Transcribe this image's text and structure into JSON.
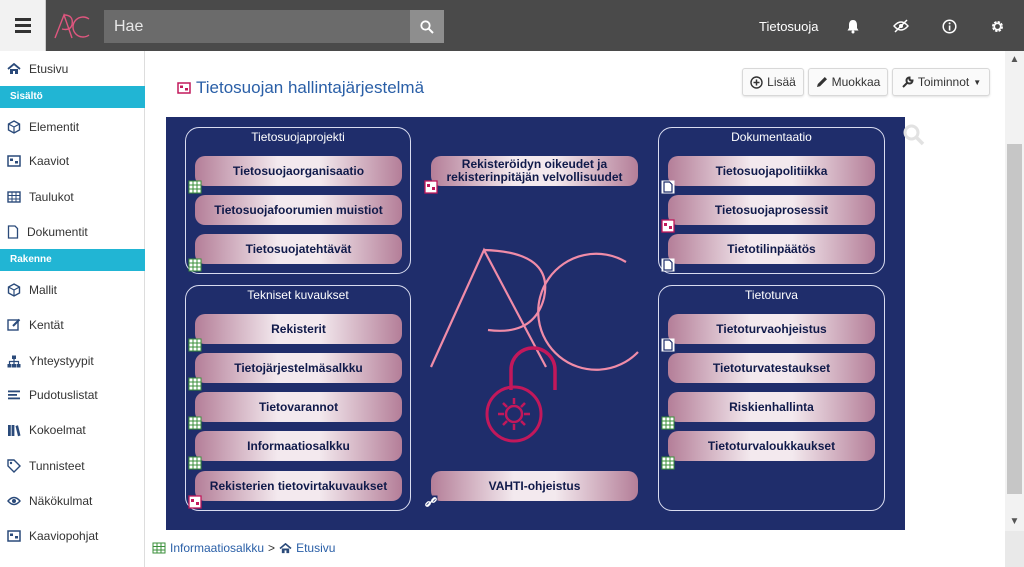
{
  "search": {
    "placeholder": "Hae"
  },
  "header": {
    "title": "Tietosuoja"
  },
  "sidebar": {
    "items": [
      {
        "label": "Etusivu",
        "icon": "home-icon"
      },
      {
        "label": "Sisältö",
        "type": "section"
      },
      {
        "label": "Elementit",
        "icon": "cubes-icon"
      },
      {
        "label": "Kaaviot",
        "icon": "diagram-icon"
      },
      {
        "label": "Taulukot",
        "icon": "table-icon"
      },
      {
        "label": "Dokumentit",
        "icon": "document-icon"
      },
      {
        "label": "Rakenne",
        "type": "section"
      },
      {
        "label": "Mallit",
        "icon": "cube-icon"
      },
      {
        "label": "Kentät",
        "icon": "edit-icon"
      },
      {
        "label": "Yhteystyypit",
        "icon": "sitemap-icon"
      },
      {
        "label": "Pudotuslistat",
        "icon": "list-icon"
      },
      {
        "label": "Kokoelmat",
        "icon": "books-icon"
      },
      {
        "label": "Tunnisteet",
        "icon": "tag-icon"
      },
      {
        "label": "Näkökulmat",
        "icon": "eye-icon"
      },
      {
        "label": "Kaaviopohjat",
        "icon": "diagram-icon"
      }
    ]
  },
  "page": {
    "title": "Tietosuojan hallintajärjestelmä",
    "toolbar": {
      "add": "Lisää",
      "edit": "Muokkaa",
      "actions": "Toiminnot"
    }
  },
  "diagram": {
    "groups": {
      "project": "Tietosuojaprojekti",
      "docs": "Dokumentaatio",
      "tech": "Tekniset kuvaukset",
      "security": "Tietoturva"
    },
    "project_items": [
      "Tietosuojaorganisaatio",
      "Tietosuojafoorumien muistiot",
      "Tietosuojatehtävät"
    ],
    "docs_items": [
      "Tietosuojapolitiikka",
      "Tietosuojaprosessit",
      "Tietotilinpäätös"
    ],
    "tech_items": [
      "Rekisterit",
      "Tietojärjestelmäsalkku",
      "Tietovarannot",
      "Informaatiosalkku",
      "Rekisterien tietovirtakuvaukset"
    ],
    "security_items": [
      "Tietoturvaohjeistus",
      "Tietoturvatestaukset",
      "Riskienhallinta",
      "Tietoturvaloukkaukset"
    ],
    "center_top": "Rekisteröidyn oikeudet ja rekisterinpitäjän  velvollisuudet",
    "center_bottom": "VAHTI-ohjeistus",
    "colors": {
      "background": "#1f2d6b",
      "logo": "#f08ca8",
      "lock": "#c2185b"
    }
  },
  "breadcrumb": {
    "first": "Informaatiosalkku",
    "separator": ">",
    "second": "Etusivu"
  }
}
